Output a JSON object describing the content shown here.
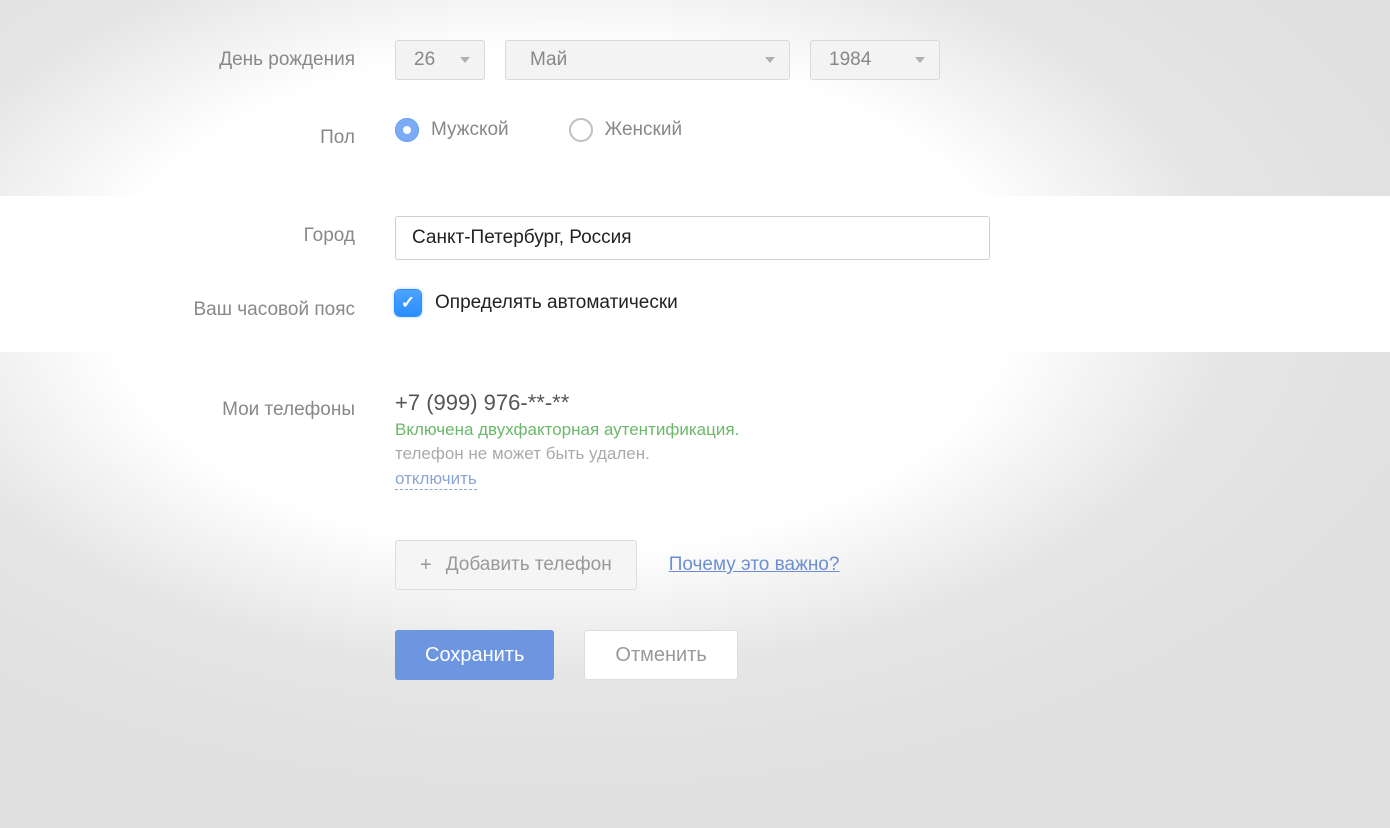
{
  "labels": {
    "birthday": "День рождения",
    "gender": "Пол",
    "city": "Город",
    "timezone": "Ваш часовой пояс",
    "phones": "Мои телефоны"
  },
  "birthday": {
    "day": "26",
    "month": "Май",
    "year": "1984"
  },
  "gender": {
    "male": "Мужской",
    "female": "Женский",
    "selected": "male"
  },
  "city": {
    "value": "Санкт-Петербург, Россия"
  },
  "timezone": {
    "auto_label": "Определять автоматически",
    "checked": true
  },
  "phone": {
    "number": "+7 (999) 976-**-**",
    "status": "Включена двухфакторная аутентификация.",
    "note": "телефон не может быть удален.",
    "disable": "отключить"
  },
  "actions": {
    "add_phone": "Добавить телефон",
    "why_important": "Почему это важно?",
    "save": "Сохранить",
    "cancel": "Отменить"
  }
}
